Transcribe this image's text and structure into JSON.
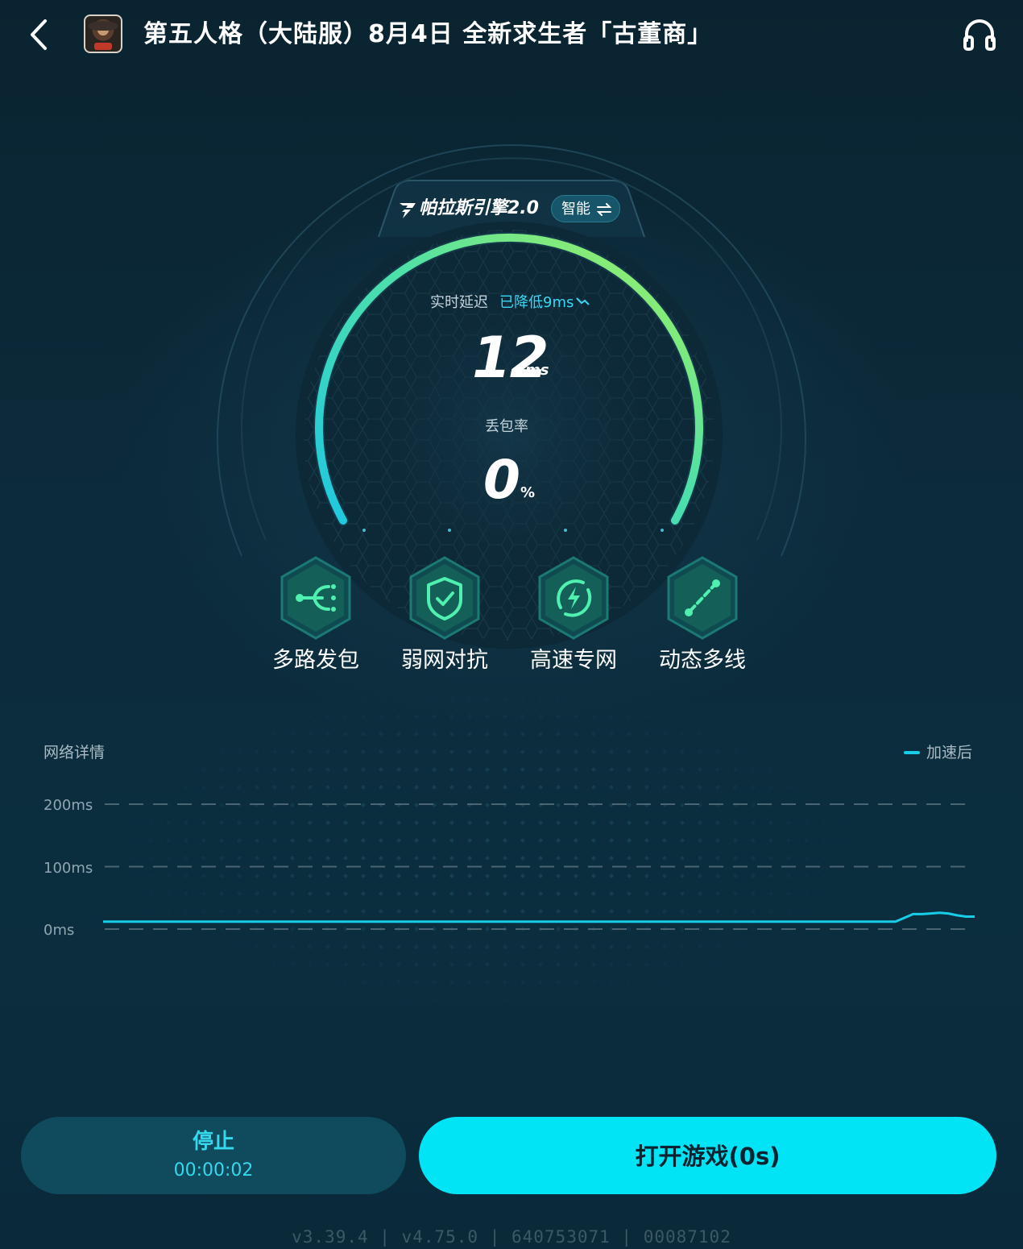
{
  "header": {
    "title": "第五人格（大陆服）8月4日 全新求生者「古董商」"
  },
  "engine": {
    "name": "帕拉斯引擎2.0",
    "mode": "智能"
  },
  "stats": {
    "latency_label": "实时延迟",
    "latency_reduced": "已降低9ms",
    "latency_value": "12",
    "latency_unit": "ms",
    "packet_loss_label": "丢包率",
    "packet_loss_value": "0",
    "packet_loss_unit": "%"
  },
  "features": [
    {
      "label": "多路发包",
      "icon": "multipath-icon"
    },
    {
      "label": "弱网对抗",
      "icon": "shield-check-icon"
    },
    {
      "label": "高速专网",
      "icon": "lightning-ring-icon"
    },
    {
      "label": "动态多线",
      "icon": "route-link-icon"
    }
  ],
  "network": {
    "title": "网络详情",
    "legend": "加速后",
    "y_ticks": [
      "200ms",
      "100ms",
      "0ms"
    ]
  },
  "chart_data": {
    "type": "line",
    "title": "网络详情",
    "yticks": [
      "200ms",
      "100ms",
      "0ms"
    ],
    "ylim": [
      0,
      200
    ],
    "series": [
      {
        "name": "加速后",
        "values": [
          12,
          12,
          12,
          12,
          12,
          12,
          12,
          12,
          12,
          12,
          12,
          12,
          12,
          12,
          12,
          12,
          12,
          12,
          12,
          12,
          12,
          12,
          12,
          12,
          12,
          12,
          12,
          12,
          12,
          12,
          12,
          12,
          12,
          12,
          12,
          12,
          12,
          12,
          12,
          12,
          12,
          12,
          12,
          12,
          12,
          12,
          12,
          12,
          12,
          12,
          12,
          12,
          12,
          12,
          12,
          12,
          12,
          12,
          12,
          12,
          12,
          12,
          12,
          12,
          12,
          12,
          12,
          12,
          12,
          12,
          12,
          12,
          12,
          12,
          12,
          12,
          12,
          12,
          12,
          12,
          12,
          12,
          12,
          12,
          12,
          12,
          12,
          12,
          12,
          12,
          12,
          18,
          24,
          24,
          25,
          26,
          25,
          22,
          20,
          20
        ]
      }
    ],
    "colors": {
      "line": "#18cde8",
      "grid": "#4b6572"
    }
  },
  "actions": {
    "stop_label": "停止",
    "timer": "00:00:02",
    "open_label": "打开游戏(0s)"
  },
  "footer": {
    "version": "v3.39.4  |  v4.75.0  |  640753071  |   00087102"
  },
  "colors": {
    "accent": "#00e4f5",
    "gauge_start": "#1ec8e0",
    "gauge_end": "#a8f25a",
    "background": "#0b2a3a"
  }
}
